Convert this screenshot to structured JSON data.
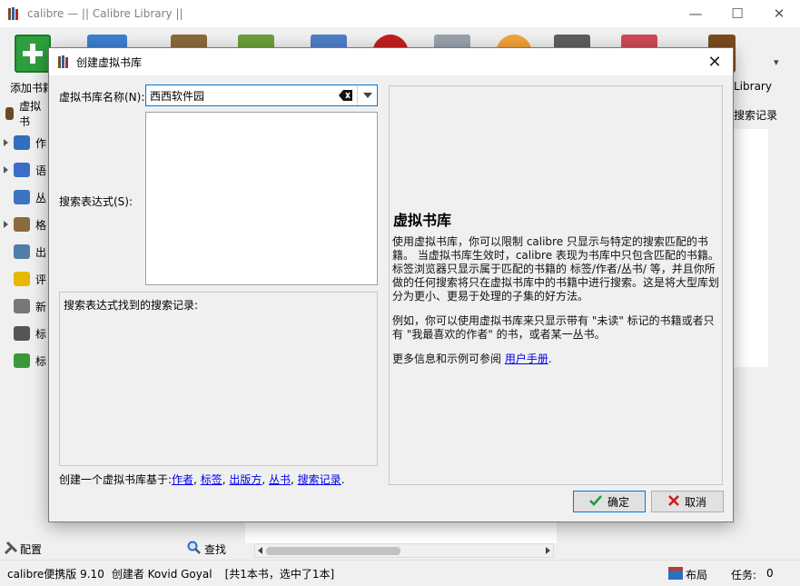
{
  "window": {
    "title": "calibre — || Calibre Library ||",
    "controls": {
      "minimize": "—",
      "maximize": "☐",
      "close": "✕"
    }
  },
  "toolbar": {
    "add_books_label": "添加书籍",
    "library_label": "Library",
    "more_arrow": "▾"
  },
  "sidebar": {
    "virtual_library_label": "虚拟书",
    "items": [
      {
        "label": "作",
        "icon": "person-icon",
        "color": "#2f6fbf",
        "expandable": true
      },
      {
        "label": "语",
        "icon": "language-icon",
        "color": "#3a6ec8",
        "expandable": true
      },
      {
        "label": "丛",
        "icon": "series-icon",
        "color": "#3d73c4",
        "expandable": false
      },
      {
        "label": "格",
        "icon": "format-icon",
        "color": "#8b6a3f",
        "expandable": true
      },
      {
        "label": "出",
        "icon": "publisher-icon",
        "color": "#4f7fa8",
        "expandable": false
      },
      {
        "label": "评",
        "icon": "star-icon",
        "color": "#e6b800",
        "expandable": false
      },
      {
        "label": "新",
        "icon": "news-icon",
        "color": "#777777",
        "expandable": false
      },
      {
        "label": "标",
        "icon": "tag-icon",
        "color": "#555555",
        "expandable": false
      },
      {
        "label": "标",
        "icon": "identifier-icon",
        "color": "#3a9a3a",
        "expandable": false
      }
    ]
  },
  "right_panel": {
    "saved_searches_label": "搜索记录"
  },
  "bottom_left": {
    "configure_label": "配置",
    "find_label": "查找"
  },
  "statusbar": {
    "version": "calibre便携版 9.10",
    "author": "创建者 Kovid Goyal",
    "count": "[共1本书，选中了1本]",
    "layout_label": "布局",
    "jobs_label": "任务:",
    "jobs_count": "0"
  },
  "dialog": {
    "title": "创建虚拟书库",
    "close": "✕",
    "name_label": "虚拟书库名称(N):",
    "name_value": "西西软件园",
    "search_label": "搜索表达式(S):",
    "search_value": "",
    "results_label": "搜索表达式找到的搜索记录:",
    "create_prefix": "创建一个虚拟书库基于:",
    "create_links": [
      "作者",
      "标签",
      "出版方",
      "丛书",
      "搜索记录"
    ],
    "help": {
      "title": "虚拟书库",
      "p1": "使用虚拟书库，你可以限制 calibre 只显示与特定的搜索匹配的书籍。 当虚拟书库生效时，calibre 表现为书库中只包含匹配的书籍。标签浏览器只显示属于匹配的书籍的 标签/作者/丛书/ 等，并且你所做的任何搜索将只在虚拟书库中的书籍中进行搜索。这是将大型库划分为更小、更易于处理的子集的好方法。",
      "p2": "例如，你可以使用虚拟书库来只显示带有 \"未读\" 标记的书籍或者只有 \"我最喜欢的作者\" 的书，或者某一丛书。",
      "p3_prefix": "更多信息和示例可参阅",
      "p3_link": "用户手册",
      "p3_suffix": "."
    },
    "ok_label": "确定",
    "cancel_label": "取消"
  },
  "colors": {
    "accent": "#0078d7",
    "ok_check": "#1e9e3e",
    "cancel_x": "#d01c1c"
  }
}
